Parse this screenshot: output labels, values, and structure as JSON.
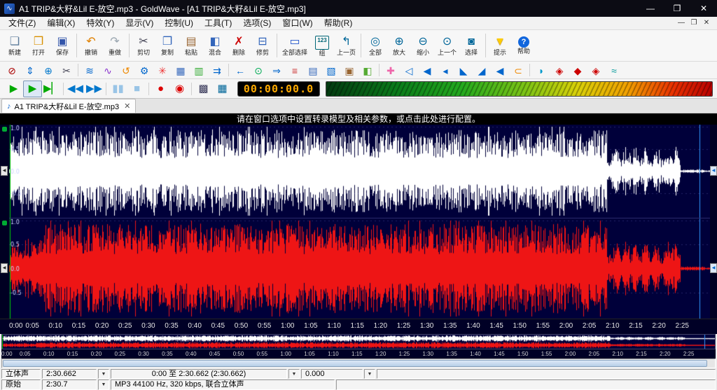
{
  "window": {
    "title": "A1 TRIP&大籽&Lil E-放空.mp3 - GoldWave - [A1 TRIP&大籽&Lil E-放空.mp3]",
    "icon_glyph": "∿",
    "min_glyph": "—",
    "restore_glyph": "❐",
    "close_glyph": "✕"
  },
  "menu": {
    "items": [
      {
        "name": "menu-file",
        "label": "文件(Z)"
      },
      {
        "name": "menu-edit",
        "label": "编辑(X)"
      },
      {
        "name": "menu-effects",
        "label": "特效(Y)"
      },
      {
        "name": "menu-view",
        "label": "显示(V)"
      },
      {
        "name": "menu-control",
        "label": "控制(U)"
      },
      {
        "name": "menu-tools",
        "label": "工具(T)"
      },
      {
        "name": "menu-options",
        "label": "选项(S)"
      },
      {
        "name": "menu-window",
        "label": "窗口(W)"
      },
      {
        "name": "menu-help",
        "label": "帮助(R)"
      }
    ],
    "mdi_min_glyph": "—",
    "mdi_restore_glyph": "❐",
    "mdi_close_glyph": "✕"
  },
  "toolbar_main": {
    "buttons": [
      {
        "name": "new-button",
        "label": "新建",
        "glyph": "❏",
        "color": "#5a7a9a"
      },
      {
        "name": "open-button",
        "label": "打开",
        "glyph": "❒",
        "color": "#d89000"
      },
      {
        "name": "save-button",
        "label": "保存",
        "glyph": "▣",
        "color": "#3355aa",
        "sep": true
      },
      {
        "name": "undo-button",
        "label": "撤销",
        "glyph": "↶",
        "color": "#e08000"
      },
      {
        "name": "redo-button",
        "label": "重做",
        "glyph": "↷",
        "color": "#9aa6b0",
        "sep": true
      },
      {
        "name": "cut-button",
        "label": "剪切",
        "glyph": "✂",
        "color": "#444455"
      },
      {
        "name": "copy-button",
        "label": "复制",
        "glyph": "❐",
        "color": "#3366bb"
      },
      {
        "name": "paste-button",
        "label": "粘贴",
        "glyph": "▤",
        "color": "#996633"
      },
      {
        "name": "mix-button",
        "label": "混合",
        "glyph": "◧",
        "color": "#3366bb"
      },
      {
        "name": "delete-button",
        "label": "删除",
        "glyph": "✗",
        "color": "#cc0000"
      },
      {
        "name": "trim-button",
        "label": "修剪",
        "glyph": "⊟",
        "color": "#3366bb",
        "sep": true
      },
      {
        "name": "select-all-button",
        "label": "全部选择",
        "glyph": "▭",
        "color": "#2255cc"
      },
      {
        "name": "preset-group-button",
        "label": "组",
        "glyph": "123",
        "cls": "ic-123"
      },
      {
        "name": "previous-page-button",
        "label": "上一页",
        "glyph": "↰",
        "color": "#006699",
        "sep": true
      },
      {
        "name": "zoom-all-button",
        "label": "全部",
        "glyph": "◎",
        "color": "#006699"
      },
      {
        "name": "zoom-in-button",
        "label": "放大",
        "glyph": "⊕",
        "color": "#006699"
      },
      {
        "name": "zoom-out-button",
        "label": "缩小",
        "glyph": "⊖",
        "color": "#006699"
      },
      {
        "name": "zoom-previous-button",
        "label": "上一个",
        "glyph": "⊙",
        "color": "#006699"
      },
      {
        "name": "zoom-selection-button",
        "label": "选择",
        "glyph": "◙",
        "color": "#006699",
        "sep": true
      },
      {
        "name": "hint-button",
        "label": "提示",
        "glyph": "▼",
        "color": "#ffcc00",
        "cls": "ic-hint"
      },
      {
        "name": "help-button",
        "label": "帮助",
        "glyph": "?",
        "cls": "ic-help"
      }
    ]
  },
  "toolbar_effects": {
    "icons": [
      {
        "name": "no-entry-icon",
        "glyph": "⊘",
        "color": "#aa0000"
      },
      {
        "name": "resize-vertical-icon",
        "glyph": "⇕",
        "color": "#0066cc"
      },
      {
        "name": "globe-icon",
        "glyph": "⊕",
        "color": "#0077cc"
      },
      {
        "name": "scissors-icon",
        "glyph": "✂",
        "color": "#444455",
        "sep": true
      },
      {
        "name": "waves-icon",
        "glyph": "≋",
        "color": "#0066cc"
      },
      {
        "name": "sine-wave-icon",
        "glyph": "∿",
        "color": "#8833cc"
      },
      {
        "name": "rotate-left-icon",
        "glyph": "↺",
        "color": "#ee8800"
      },
      {
        "name": "gear-icon",
        "glyph": "⚙",
        "color": "#0066cc"
      },
      {
        "name": "burst-icon",
        "glyph": "✳",
        "color": "#ee3333"
      },
      {
        "name": "grid-icon",
        "glyph": "▦",
        "color": "#3366bb"
      },
      {
        "name": "bars-icon",
        "glyph": "▥",
        "color": "#33aa33"
      },
      {
        "name": "double-arrow-right-icon",
        "glyph": "⇉",
        "color": "#0066cc",
        "sep": true
      },
      {
        "name": "left-arrow-icon",
        "glyph": "←",
        "color": "#0066cc"
      },
      {
        "name": "target-icon",
        "glyph": "⊙",
        "color": "#00aa55"
      },
      {
        "name": "right-arrow-icon",
        "glyph": "⇒",
        "color": "#0066cc"
      },
      {
        "name": "eq-lines-icon",
        "glyph": "≡",
        "color": "#cc3333"
      },
      {
        "name": "rows-icon",
        "glyph": "▤",
        "color": "#3366bb"
      },
      {
        "name": "diag-grid-icon",
        "glyph": "▧",
        "color": "#0066cc"
      },
      {
        "name": "barrel-icon",
        "glyph": "▣",
        "color": "#996633"
      },
      {
        "name": "half-block-icon",
        "glyph": "◧",
        "color": "#55aa33",
        "sep": true
      },
      {
        "name": "plus-icon",
        "glyph": "✚",
        "color": "#ee66aa"
      },
      {
        "name": "speaker-mute-icon",
        "glyph": "◁",
        "color": "#0066cc"
      },
      {
        "name": "speaker-icon",
        "glyph": "◀",
        "color": "#0066cc"
      },
      {
        "name": "volume-small-icon",
        "glyph": "◂",
        "color": "#0066cc"
      },
      {
        "name": "corner-left-icon",
        "glyph": "◣",
        "color": "#0066cc"
      },
      {
        "name": "corner-right-icon",
        "glyph": "◢",
        "color": "#0066cc"
      },
      {
        "name": "skip-left-icon",
        "glyph": "◀",
        "color": "#0066cc"
      },
      {
        "name": "link-icon",
        "glyph": "⊂",
        "color": "#ee8800",
        "sep": true
      },
      {
        "name": "speech-bubble-icon",
        "glyph": "◗",
        "color": "#0099cc"
      },
      {
        "name": "diamond-left-icon",
        "glyph": "◈",
        "color": "#cc0000"
      },
      {
        "name": "diamond-icon",
        "glyph": "◆",
        "color": "#cc0000"
      },
      {
        "name": "diamond-right-icon",
        "glyph": "◈",
        "color": "#cc0000"
      },
      {
        "name": "approx-icon",
        "glyph": "≈",
        "color": "#009999"
      }
    ]
  },
  "transport": {
    "buttons": [
      {
        "name": "play-button",
        "glyph": "▶",
        "color": "#00aa00"
      },
      {
        "name": "play-selection-button",
        "glyph": "▶",
        "color": "#00aa00",
        "pressed": true
      },
      {
        "name": "play-end-button",
        "glyph": "▶▏",
        "color": "#00aa00",
        "sep": true
      },
      {
        "name": "rewind-button",
        "glyph": "◀◀",
        "color": "#0077cc"
      },
      {
        "name": "fast-forward-button",
        "glyph": "▶▶",
        "color": "#0077cc",
        "sep": true
      },
      {
        "name": "pause-button",
        "glyph": "▮▮",
        "color": "#99c4e6"
      },
      {
        "name": "stop-button",
        "glyph": "■",
        "color": "#99c4e6",
        "sep": true
      },
      {
        "name": "record-button",
        "glyph": "●",
        "color": "#dd0000"
      },
      {
        "name": "record-selection-button",
        "glyph": "◉",
        "color": "#dd0000",
        "sep": true
      },
      {
        "name": "control-properties-button",
        "glyph": "▩",
        "color": "#333355"
      },
      {
        "name": "visual-display-button",
        "glyph": "▦",
        "color": "#006699"
      }
    ],
    "time_display": "00:00:00.0"
  },
  "tabbar": {
    "icon_glyph": "♪",
    "tabs": [
      {
        "label": "A1 TRIP&大籽&Lil E-放空.mp3",
        "close_glyph": "✕"
      }
    ]
  },
  "notice": {
    "text": "请在窗口选项中设置转录模型及相关参数，或点击此处进行配置。"
  },
  "waveform": {
    "amplitude_labels": [
      "1.0",
      "0.5",
      "0.0",
      "-0.5"
    ],
    "colors": {
      "bg": "#00003a",
      "left_channel": "#ffffff",
      "right_channel": "#ee1515",
      "grid": "#222266",
      "marker_start": "#00cc00",
      "marker_end": "#3399ff"
    },
    "markers": {
      "start_p": 0.001,
      "end_p": 0.985
    },
    "loud_until_p": 0.853,
    "duration_seconds": 150.662
  },
  "timeline": {
    "view_seconds": 151,
    "step_seconds": 5,
    "labels": [
      "0:00",
      "0:05",
      "0:10",
      "0:15",
      "0:20",
      "0:25",
      "0:30",
      "0:35",
      "0:40",
      "0:45",
      "0:50",
      "0:55",
      "1:00",
      "1:05",
      "1:10",
      "1:15",
      "1:20",
      "1:25",
      "1:30",
      "1:35",
      "1:40",
      "1:45",
      "1:50",
      "1:55",
      "2:00",
      "2:05",
      "2:10",
      "2:15",
      "2:20",
      "2:25"
    ]
  },
  "statusbar": {
    "dropdown_glyph": "▼",
    "channels": "立体声",
    "length": "2:30.662",
    "selection": "0:00 至 2:30.662 (2:30.662)",
    "position": "0.000",
    "original_label": "原始",
    "original_length": "2:30.7",
    "format": "MP3 44100 Hz, 320 kbps, 联合立体声"
  }
}
